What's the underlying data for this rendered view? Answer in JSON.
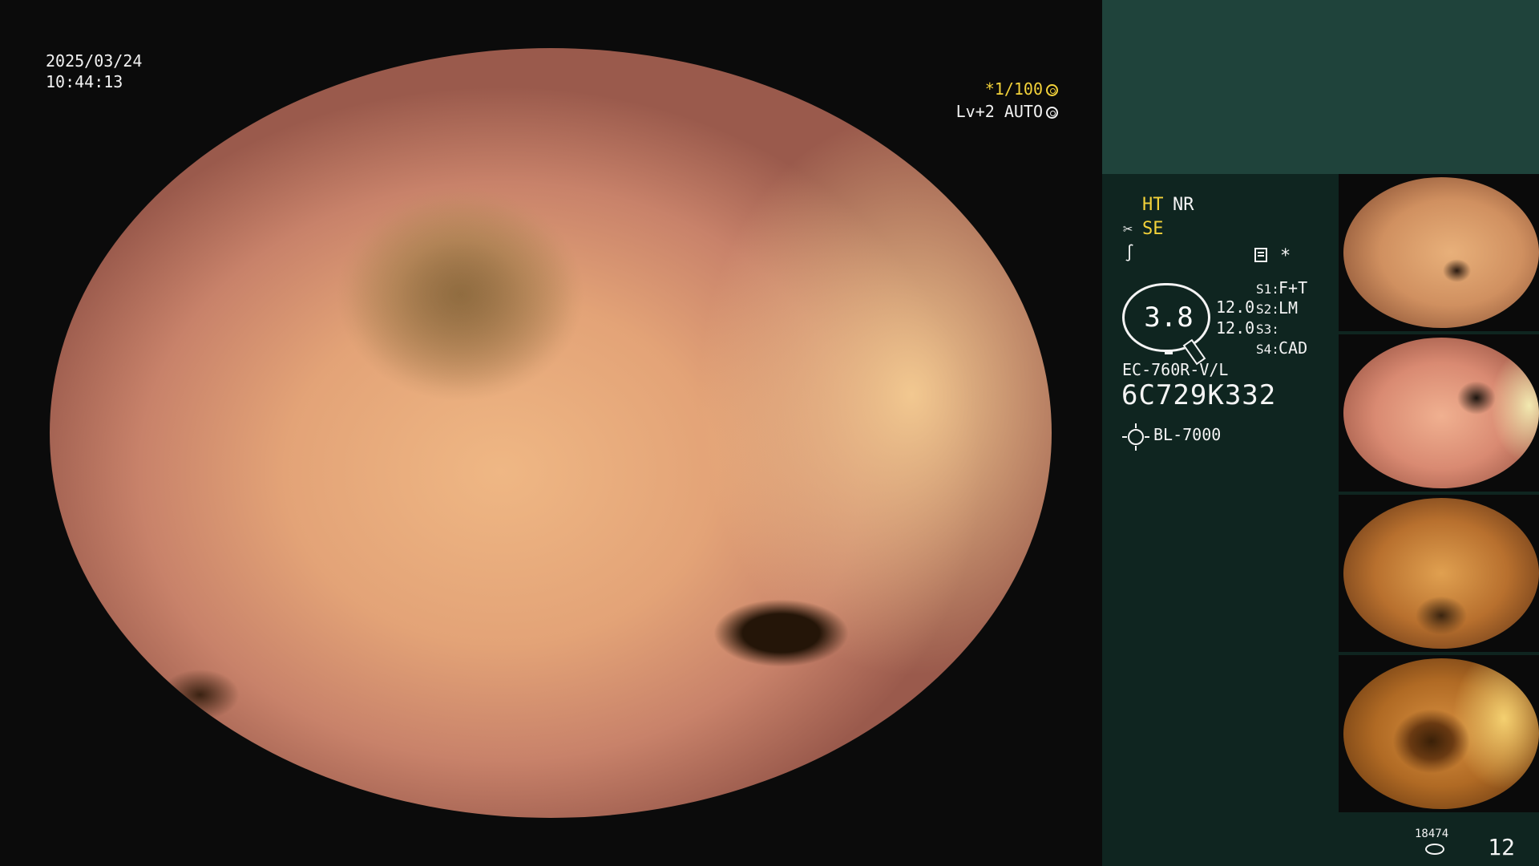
{
  "overlay": {
    "date": "2025/03/24",
    "time": "10:44:13",
    "shutter": "*1/100",
    "level": "Lv+2 AUTO"
  },
  "panel": {
    "ht": "HT",
    "nr": "NR",
    "se": "SE",
    "asterisk": "*",
    "gauge_value": "3.8",
    "val1": "12.0",
    "val2": "12.0",
    "s1": "S1:",
    "s1_value": "F+T",
    "s2": "S2:",
    "s2_value": "LM",
    "s3": "S3:",
    "s4": "S4:",
    "s4_value": "CAD",
    "scope_model": "EC-760R-V/L",
    "serial": "6C729K332",
    "light_source": "BL-7000"
  },
  "counter": {
    "small": "18474",
    "count": "12"
  },
  "colors": {
    "panel_top": "#1f433b",
    "panel_bg": "#0f2520",
    "accent_yellow": "#f3d23a"
  },
  "icons": [
    "aperture-icon",
    "auto-circle-icon",
    "scissors-icon",
    "wave-icon",
    "document-icon",
    "pen-icon",
    "sun-icon",
    "disk-icon"
  ]
}
